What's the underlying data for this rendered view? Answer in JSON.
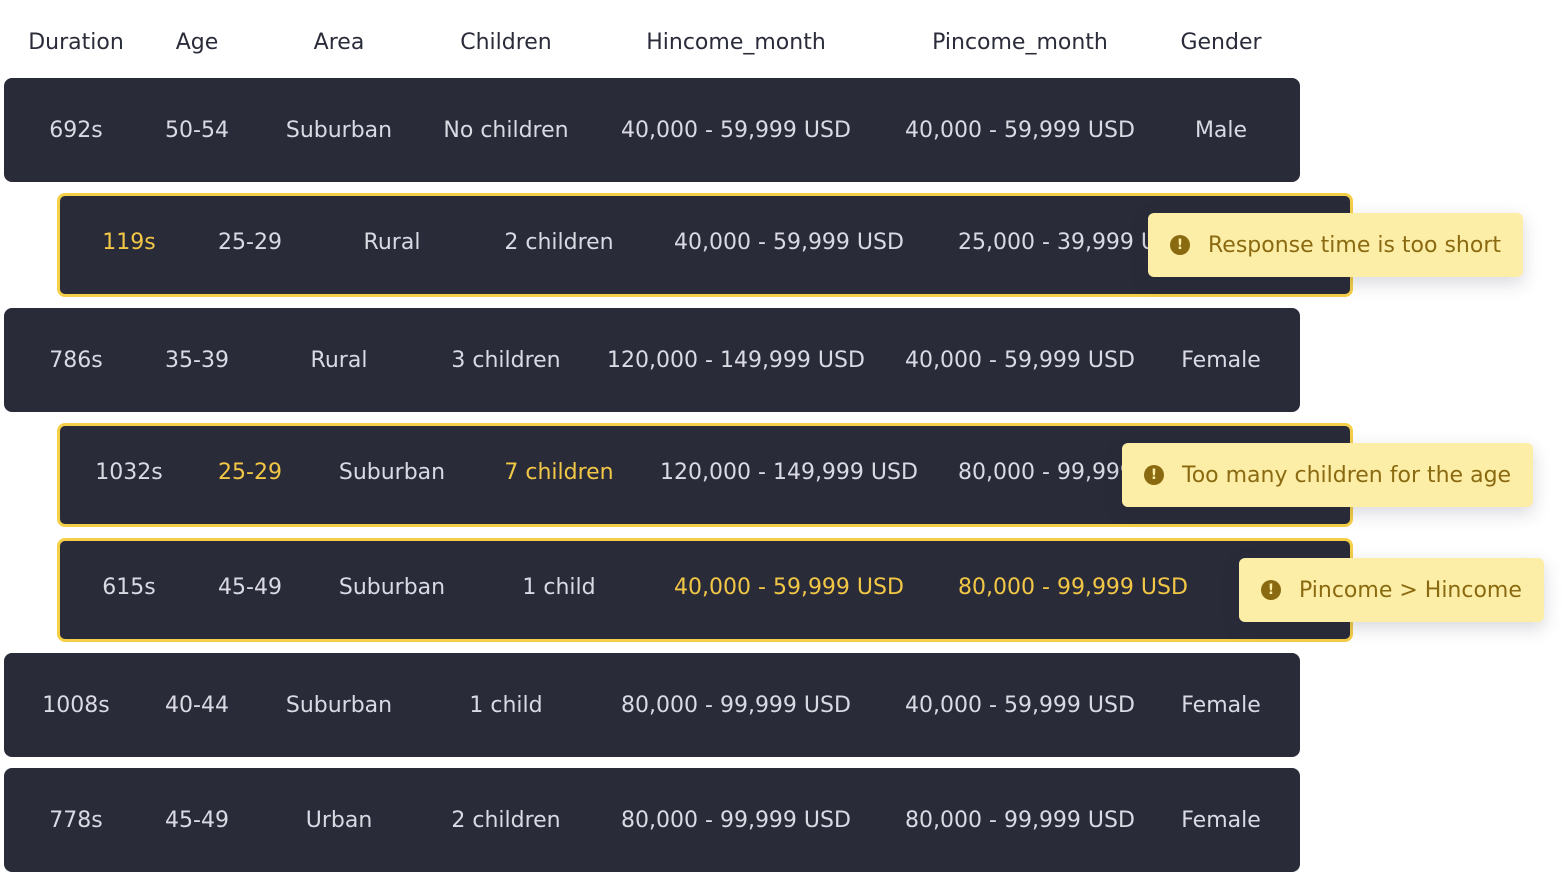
{
  "columns": [
    "Duration",
    "Age",
    "Area",
    "Children",
    "Hincome_month",
    "Pincome_month",
    "Gender"
  ],
  "rows": [
    {
      "cells": [
        "692s",
        "50-54",
        "Suburban",
        "No children",
        "40,000 - 59,999 USD",
        "40,000 - 59,999 USD",
        "Male"
      ],
      "flagged": false,
      "highlight": []
    },
    {
      "cells": [
        "119s",
        "25-29",
        "Rural",
        "2 children",
        "40,000 - 59,999 USD",
        "25,000 - 39,999 USD",
        ""
      ],
      "flagged": true,
      "highlight": [
        0
      ]
    },
    {
      "cells": [
        "786s",
        "35-39",
        "Rural",
        "3 children",
        "120,000 - 149,999 USD",
        "40,000 - 59,999 USD",
        "Female"
      ],
      "flagged": false,
      "highlight": []
    },
    {
      "cells": [
        "1032s",
        "25-29",
        "Suburban",
        "7 children",
        "120,000 - 149,999 USD",
        "80,000 - 99,999 USD",
        ""
      ],
      "flagged": true,
      "highlight": [
        1,
        3
      ]
    },
    {
      "cells": [
        "615s",
        "45-49",
        "Suburban",
        "1 child",
        "40,000 - 59,999 USD",
        "80,000 - 99,999 USD",
        ""
      ],
      "flagged": true,
      "highlight": [
        4,
        5
      ]
    },
    {
      "cells": [
        "1008s",
        "40-44",
        "Suburban",
        "1 child",
        "80,000 - 99,999 USD",
        "40,000 - 59,999 USD",
        "Female"
      ],
      "flagged": false,
      "highlight": []
    },
    {
      "cells": [
        "778s",
        "45-49",
        "Urban",
        "2 children",
        "80,000 - 99,999 USD",
        "80,000 - 99,999 USD",
        "Female"
      ],
      "flagged": false,
      "highlight": []
    }
  ],
  "warnings": [
    {
      "row": 1,
      "text": "Response time is too short",
      "icon": "warning-circle-icon"
    },
    {
      "row": 3,
      "text": "Too many children for the age",
      "icon": "warning-circle-icon"
    },
    {
      "row": 4,
      "text": "Pincome > Hincome",
      "icon": "warning-circle-icon"
    }
  ],
  "colors": {
    "row_bg": "#292b39",
    "row_text": "#d9dae3",
    "highlight_text": "#f2c746",
    "flag_border": "#f5cf47",
    "tooltip_bg": "#fdeea7",
    "tooltip_text": "#8a6a10"
  }
}
